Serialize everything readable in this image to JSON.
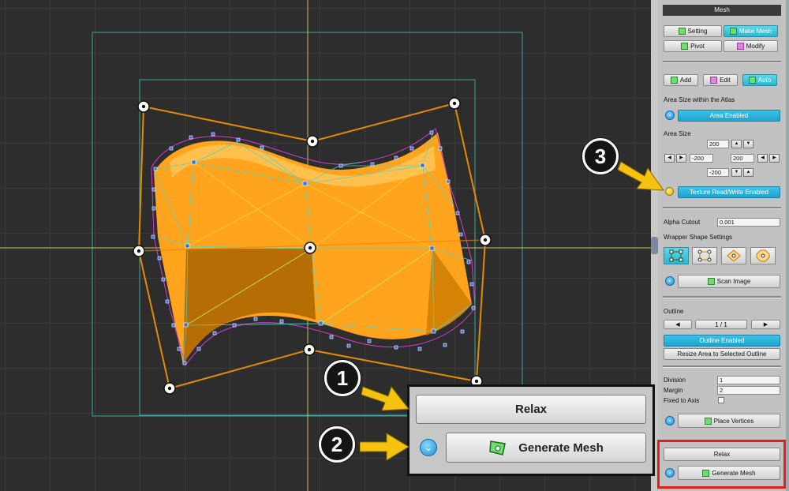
{
  "panel": {
    "title": "Mesh",
    "tabs": {
      "setting": "Setting",
      "make_mesh": "Make Mesh",
      "pivot": "Pivot",
      "modify": "Modify"
    },
    "modes": {
      "add": "Add",
      "edit": "Edit",
      "auto": "Auto"
    },
    "area_size_atlas_label": "Area Size within the Atlas",
    "area_enabled": "Area Enabled",
    "area_size_label": "Area Size",
    "area_values": {
      "top": "200",
      "left": "-200",
      "right": "200",
      "bottom": "-200"
    },
    "texture_rw": "Texture Read/Write Enabled",
    "alpha_cutout_label": "Alpha Cutout",
    "alpha_cutout_value": "0.001",
    "wrapper_label": "Wrapper Shape Settings",
    "scan_image": "Scan Image",
    "outline_label": "Outline",
    "outline_page": "1 / 1",
    "outline_enabled": "Outline Enabled",
    "resize_area": "Resize Area to Selected Outline",
    "division_label": "Division",
    "division_value": "1",
    "margin_label": "Margin",
    "margin_value": "2",
    "fixed_axis_label": "Fixed to Axis",
    "place_vertices": "Place Vertices",
    "relax": "Relax",
    "generate_mesh": "Generate Mesh"
  },
  "zoom": {
    "relax": "Relax",
    "generate_mesh": "Generate Mesh"
  },
  "callouts": [
    "1",
    "2",
    "3"
  ],
  "colors": {
    "accent": "#2bb7cf",
    "highlight": "#e0201b",
    "arrow": "#f5c20f",
    "shape_fill": "#ffa41c",
    "outline": "#e68a00",
    "mesh_line": "#4fd6c8"
  },
  "icons": {
    "texture_status": "yellow-circle-icon",
    "dropdown": "chevron-down-icon"
  }
}
